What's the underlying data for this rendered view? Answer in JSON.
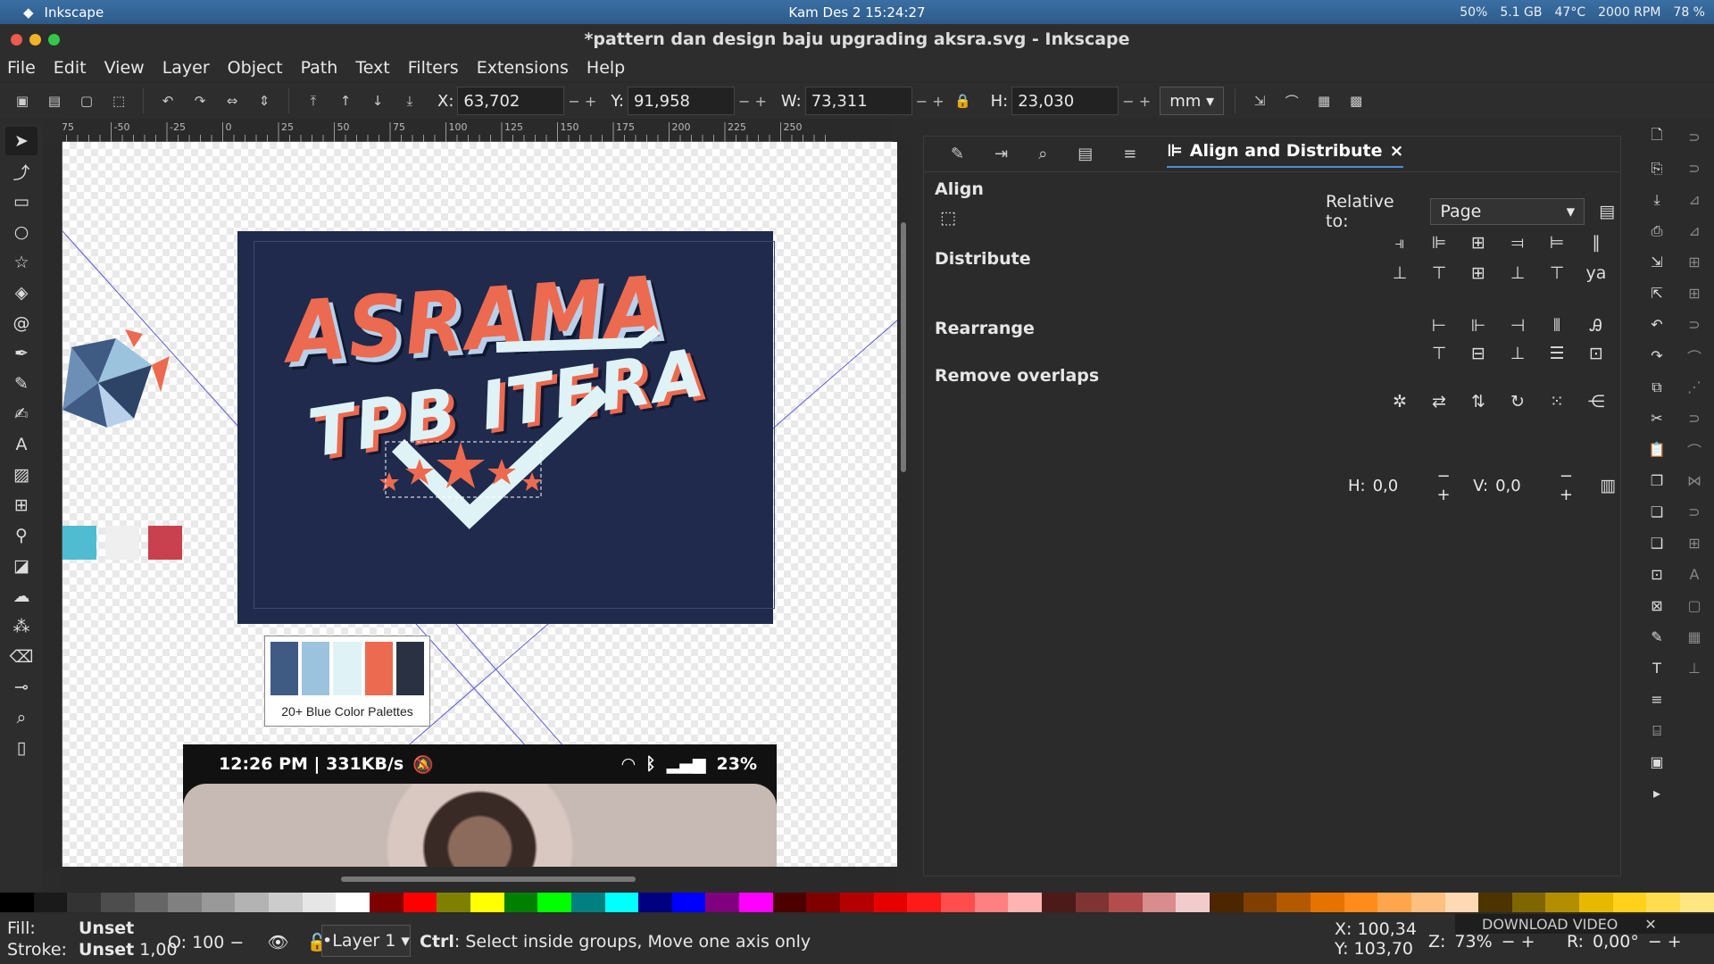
{
  "system_bar": {
    "app_name": "Inkscape",
    "datetime": "Kam Des 2  15:24:27",
    "cpu": "50%",
    "mem": "5.1 GB",
    "temp": "47°C",
    "fan": "2000 RPM",
    "battery": "78 %"
  },
  "window": {
    "title": "*pattern dan design baju upgrading aksra.svg - Inkscape"
  },
  "menu": [
    "File",
    "Edit",
    "View",
    "Layer",
    "Object",
    "Path",
    "Text",
    "Filters",
    "Extensions",
    "Help"
  ],
  "controls": {
    "x_label": "X:",
    "x_value": "63,702",
    "y_label": "Y:",
    "y_value": "91,958",
    "w_label": "W:",
    "w_value": "73,311",
    "h_label": "H:",
    "h_value": "23,030",
    "unit": "mm"
  },
  "ruler_ticks": [
    "-75",
    "-50",
    "-25",
    "0",
    "25",
    "50",
    "75",
    "100",
    "125",
    "150",
    "175",
    "200",
    "225",
    "250"
  ],
  "canvas": {
    "design_line1": "ASRAMA",
    "design_line2": "TPB ITERA",
    "palette_label": "20+ Blue Color Palettes",
    "phone_status": "12:26 PM | 331KB/s",
    "phone_battery": "23%"
  },
  "panel": {
    "tab_title": "Align and Distribute",
    "section_align": "Align",
    "relative_label": "Relative to:",
    "relative_value": "Page",
    "section_distribute": "Distribute",
    "section_rearrange": "Rearrange",
    "section_overlaps": "Remove overlaps",
    "h_label": "H:",
    "h_value": "0,0",
    "v_label": "V:",
    "v_value": "0,0"
  },
  "status": {
    "fill_label": "Fill:",
    "fill_value": "Unset",
    "stroke_label": "Stroke:",
    "stroke_value": "Unset",
    "stroke_width": "1,00",
    "opacity_label": "O:",
    "opacity_value": "100",
    "layer": "•Layer 1",
    "message_key": "Ctrl",
    "message": ": Select inside groups, Move one axis only",
    "cursor_x": "100,34",
    "cursor_y": "103,70",
    "zoom_label": "Z:",
    "zoom_value": "73%",
    "rotation_label": "R:",
    "rotation_value": "0,00°",
    "download_video": "DOWNLOAD VIDEO"
  },
  "palette_colors": [
    "#3f5a83",
    "#9cc3dd",
    "#dff3f7",
    "#ec6a50",
    "#2a3142"
  ],
  "tri_swatches": [
    "#4fbcd1",
    "#efefef",
    "#c9404e"
  ],
  "color_strip": [
    "#000000",
    "#1a1a1a",
    "#333333",
    "#4d4d4d",
    "#666666",
    "#808080",
    "#999999",
    "#b3b3b3",
    "#cccccc",
    "#e6e6e6",
    "#ffffff",
    "#800000",
    "#ff0000",
    "#808000",
    "#ffff00",
    "#008000",
    "#00ff00",
    "#008080",
    "#00ffff",
    "#000080",
    "#0000ff",
    "#800080",
    "#ff00ff",
    "#4d0000",
    "#800000",
    "#b30000",
    "#e60000",
    "#ff1a1a",
    "#ff4d4d",
    "#ff8080",
    "#ffb3b3",
    "#4d1a1a",
    "#803333",
    "#b34d4d",
    "#d98c8c",
    "#f2cccc",
    "#4d2600",
    "#803f00",
    "#b35900",
    "#e67300",
    "#ff8c1a",
    "#ffa64d",
    "#ffbf80",
    "#ffd9b3",
    "#4d3300",
    "#806600",
    "#b38f00",
    "#e6b800",
    "#ffd11a",
    "#ffdd4d",
    "#ffe680"
  ]
}
